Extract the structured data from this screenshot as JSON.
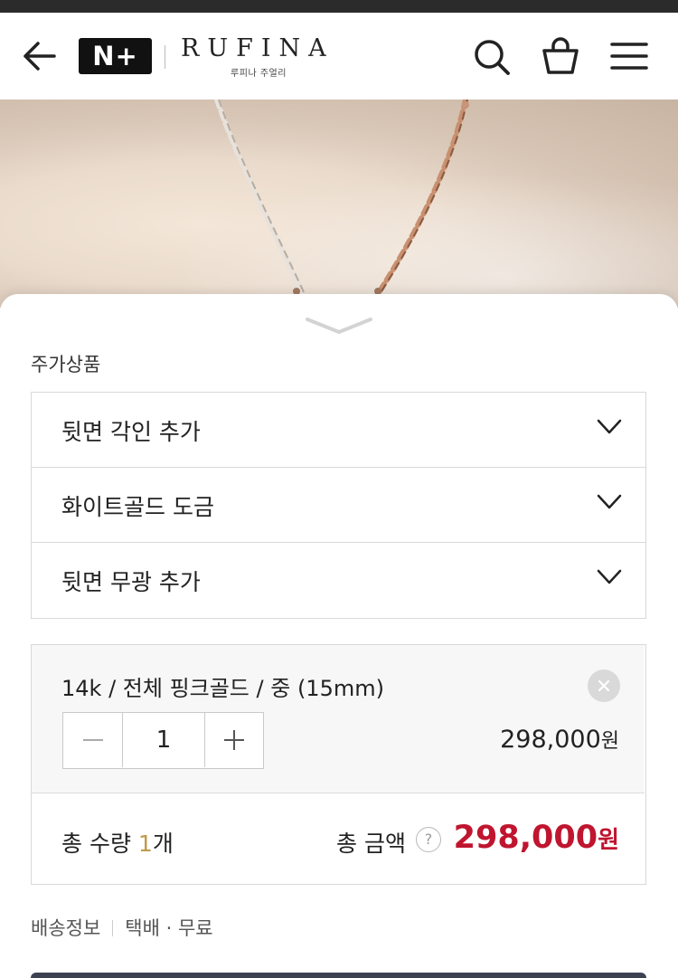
{
  "header": {
    "logo_mark": "N+",
    "brand_name": "RUFINA",
    "brand_sub": "루피나 주얼리",
    "icons": [
      "back-arrow-icon",
      "search-icon",
      "shopping-bag-icon",
      "hamburger-menu-icon"
    ]
  },
  "additional": {
    "label": "주가상품",
    "options": [
      {
        "label": "뒷면 각인 추가"
      },
      {
        "label": "화이트골드 도금"
      },
      {
        "label": "뒷면 무광 추가"
      }
    ]
  },
  "selected": {
    "name": "14k / 전체 핑크골드 / 중 (15mm)",
    "quantity": "1",
    "price": "298,000",
    "price_unit": "원"
  },
  "total": {
    "qty_prefix": "총 수량 ",
    "qty_value": "1",
    "qty_suffix": "개",
    "amount_label": "총 금액",
    "help": "?",
    "price": "298,000",
    "price_unit": "원"
  },
  "shipping": {
    "label": "배송정보",
    "value": "택배 · 무료"
  },
  "colors": {
    "accent_price": "#c0152f",
    "qty_highlight": "#c09a48",
    "header_bg": "#ffffff",
    "selected_bg": "#f7f7f7"
  }
}
